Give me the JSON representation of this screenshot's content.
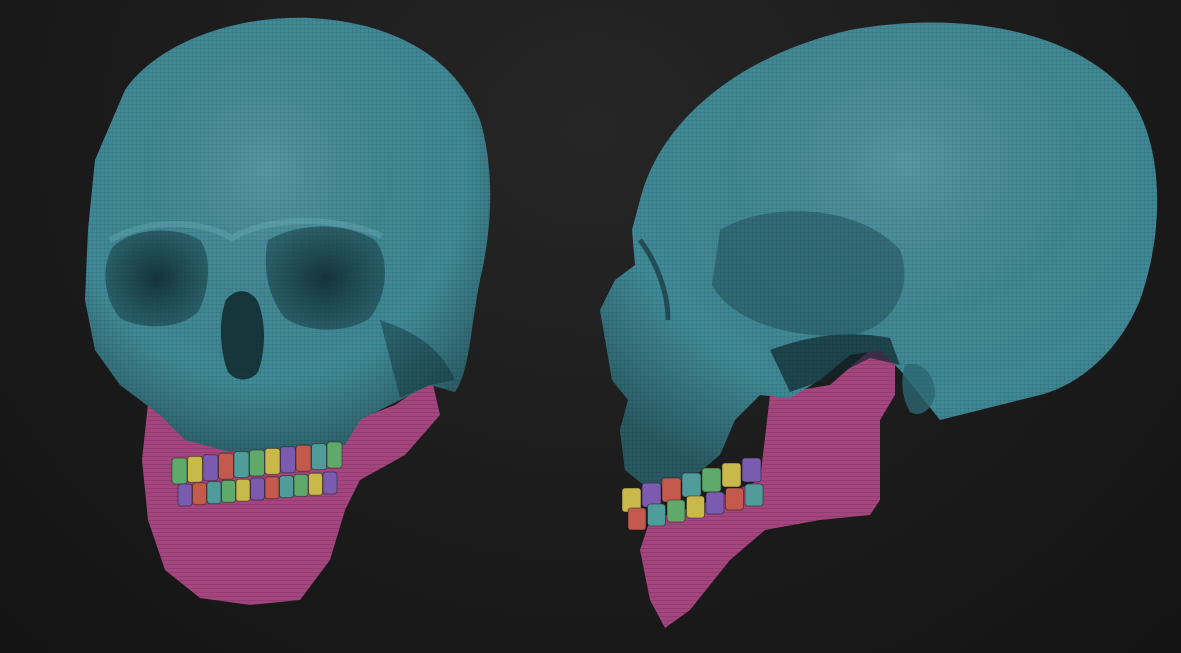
{
  "scene": {
    "background_color": "#1c1c1c",
    "skull_color": "#3f8a97",
    "skull_shadow_color": "#25565f",
    "jaw_color": "#a4457f",
    "jaw_shadow_color": "#6d2a55",
    "tooth_colors": [
      "#5faa6a",
      "#c8b94a",
      "#7b5bb0",
      "#c45a4e",
      "#4f9c9a"
    ],
    "views": [
      {
        "name": "front-three-quarter-view"
      },
      {
        "name": "side-view"
      }
    ]
  }
}
